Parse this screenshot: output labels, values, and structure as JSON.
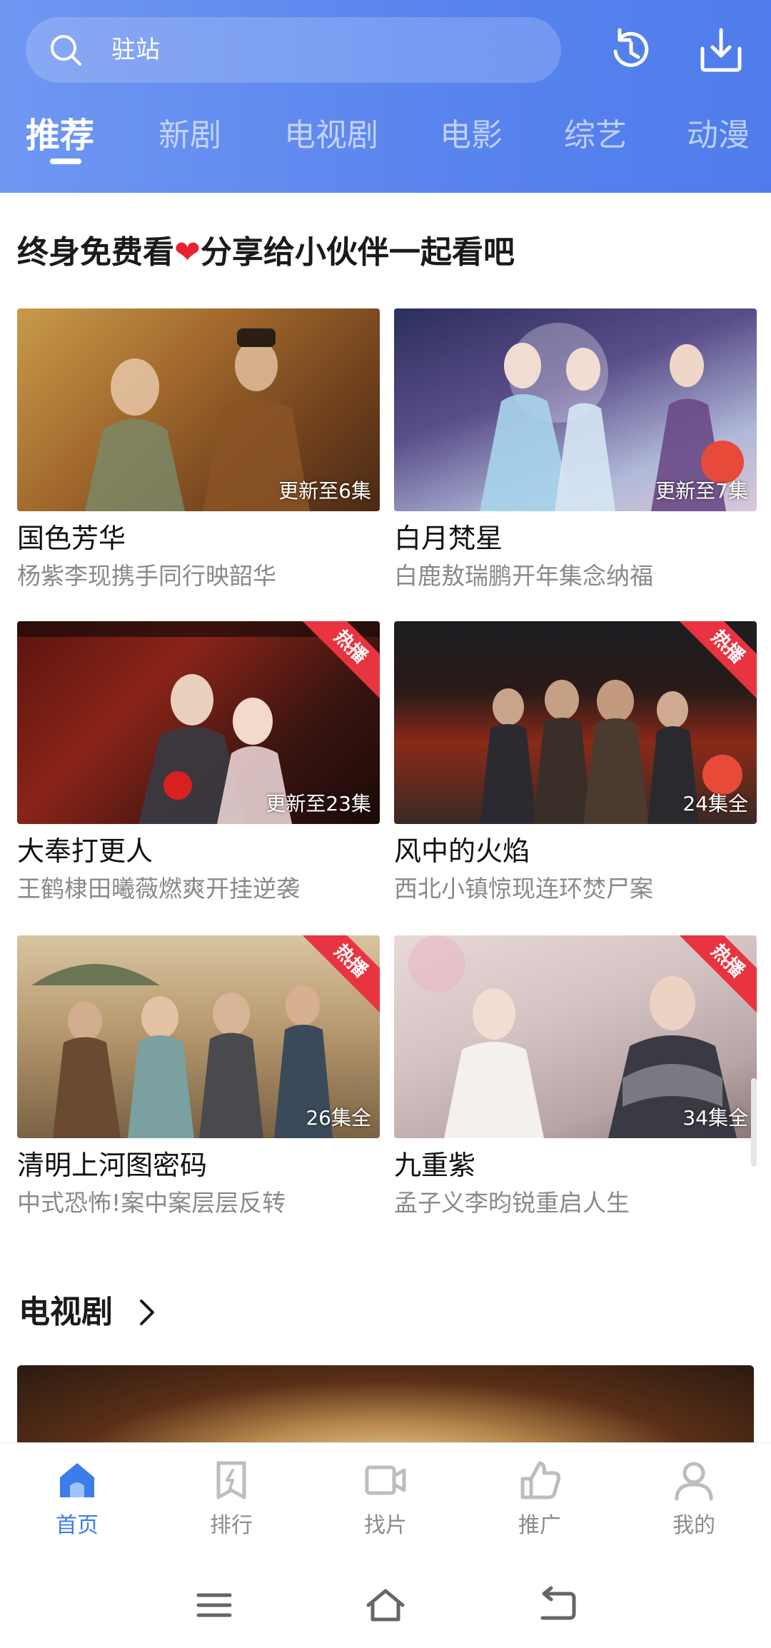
{
  "search": {
    "placeholder": "驻站"
  },
  "tabs": [
    {
      "label": "推荐",
      "active": true
    },
    {
      "label": "新剧"
    },
    {
      "label": "电视剧"
    },
    {
      "label": "电影"
    },
    {
      "label": "综艺"
    },
    {
      "label": "动漫"
    }
  ],
  "section": {
    "title_before": "终身免费看",
    "title_after": "分享给小伙伴一起看吧"
  },
  "cards": [
    {
      "title": "国色芳华",
      "sub": "杨紫李现携手同行映韶华",
      "badge": "更新至6集",
      "hot": ""
    },
    {
      "title": "白月梵星",
      "sub": "白鹿敖瑞鹏开年集念纳福",
      "badge": "更新至7集",
      "hot": ""
    },
    {
      "title": "大奉打更人",
      "sub": "王鹤棣田曦薇燃爽开挂逆袭",
      "badge": "更新至23集",
      "hot": "热播"
    },
    {
      "title": "风中的火焰",
      "sub": "西北小镇惊现连环焚尸案",
      "badge": "24集全",
      "hot": "热播"
    },
    {
      "title": "清明上河图密码",
      "sub": "中式恐怖!案中案层层反转",
      "badge": "26集全",
      "hot": "热播"
    },
    {
      "title": "九重紫",
      "sub": "孟子义李昀锐重启人生",
      "badge": "34集全",
      "hot": "热播"
    }
  ],
  "tv_section": {
    "title": "电视剧"
  },
  "bottom_nav": [
    {
      "label": "首页",
      "icon": "home-icon",
      "active": true
    },
    {
      "label": "排行",
      "icon": "rank-icon"
    },
    {
      "label": "找片",
      "icon": "video-icon"
    },
    {
      "label": "推广",
      "icon": "thumb-icon"
    },
    {
      "label": "我的",
      "icon": "user-icon"
    }
  ],
  "colors": {
    "accent": "#3d7de8",
    "header": "#5a85ee",
    "hot_ribbon": "#e83440"
  }
}
